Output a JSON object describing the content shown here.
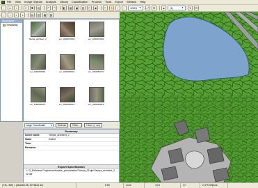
{
  "menu": [
    "File",
    "View",
    "Image Objects",
    "Analysis",
    "Library",
    "Classification",
    "Process",
    "Tools",
    "Export",
    "Window",
    "Help"
  ],
  "toolbar": {
    "zoom": "100%",
    "layer": "(1)"
  },
  "tree": {
    "title": "Workspace",
    "items": [
      "TampaBay"
    ]
  },
  "thumbnails": [
    {
      "caption": "Tampa_architect_2"
    },
    {
      "caption": "ver_1060070002"
    },
    {
      "caption": "ver_1060070003"
    },
    {
      "caption": "ver_1060050090"
    },
    {
      "caption": "ver_1060050001"
    },
    {
      "caption": "ver_1060050070"
    },
    {
      "caption": "ver_1060050070"
    },
    {
      "caption": "ver_1060050012"
    },
    {
      "caption": "ver_1060050013"
    }
  ],
  "thumb_controls": {
    "view_mode": "Large Thumbnails",
    "refresh_label": "Refresh",
    "filter_label": "Filter...",
    "count": "9 item (1 sel)"
  },
  "summary": {
    "title": "Summary",
    "rows": [
      {
        "key": "Scene name:",
        "value": "Tampa_architect_2"
      },
      {
        "key": "State:",
        "value": "Edited"
      },
      {
        "key": "Time:",
        "value": ""
      },
      {
        "key": "Remarks:",
        "value": ""
      }
    ],
    "export_title": "Export Specification",
    "export_path": "1: \\3_Definiens Projects\\arithmetic_presentation\\Tampa_01\\dpr\\Tampa_architect_2-v2.dpr"
  },
  "status": {
    "coords": "(731, 365) = (364460.08, 3073641.42)",
    "depth": "8 bit",
    "mode": "none",
    "level": "1/13",
    "field": "17",
    "objects": "2,379 Objects"
  },
  "colors": {
    "water": "#7ea3cc",
    "vegetation": "#54a032",
    "segment_lines": "#1f3d10",
    "roof": "#6e6e6e",
    "pavement": "#b4b4b4"
  }
}
